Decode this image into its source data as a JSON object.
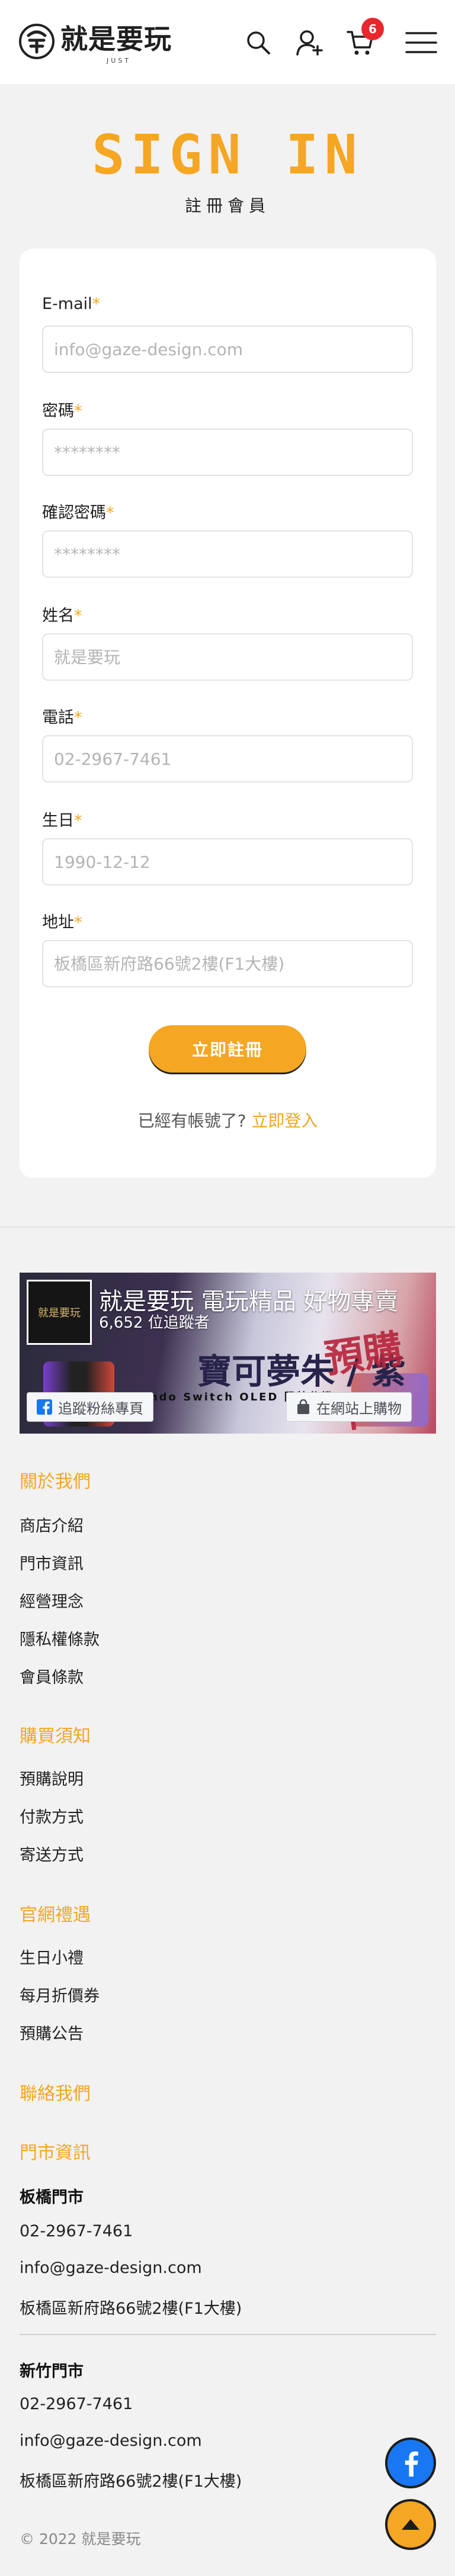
{
  "header": {
    "logo_text": "就是要玩",
    "logo_sub": "JUST",
    "cart_count": "6",
    "icons": [
      "search-icon",
      "user-add-icon",
      "cart-icon",
      "hamburger-menu-icon"
    ]
  },
  "page": {
    "title": "SIGN IN",
    "subtitle": "註冊會員"
  },
  "form": {
    "required_mark": "*",
    "fields": [
      {
        "label": "E-mail",
        "placeholder": "info@gaze-design.com",
        "type": "email"
      },
      {
        "label": "密碼",
        "placeholder": "********",
        "type": "password"
      },
      {
        "label": "確認密碼",
        "placeholder": "********",
        "type": "password"
      },
      {
        "label": "姓名",
        "placeholder": "就是要玩",
        "type": "text"
      },
      {
        "label": "電話",
        "placeholder": "02-2967-7461",
        "type": "tel"
      },
      {
        "label": "生日",
        "placeholder": "1990-12-12",
        "type": "text"
      },
      {
        "label": "地址",
        "placeholder": "板橋區新府路66號2樓(F1大樓)",
        "type": "text"
      }
    ],
    "submit_label": "立即註冊",
    "login_prompt": "已經有帳號了?",
    "login_link": "立即登入"
  },
  "facebook": {
    "page_name": "就是要玩 電玩精品 好物專賣",
    "likes": "6,652 位追蹤者",
    "follow_label": "追蹤粉絲專頁",
    "shop_label": "在網站上購物",
    "avatar_text": "就是要玩",
    "promo_big": "寶可夢朱 / 紫",
    "promo_red": "預購中",
    "promo_small": "Nintendo Switch OLED 限特仕機"
  },
  "footer": {
    "about": {
      "title": "關於我們",
      "links": [
        "商店介紹",
        "門市資訊",
        "經營理念",
        "隱私權條款",
        "會員條款"
      ]
    },
    "purchase": {
      "title": "購買須知",
      "links": [
        "預購說明",
        "付款方式",
        "寄送方式"
      ]
    },
    "gifts": {
      "title": "官網禮遇",
      "links": [
        "生日小禮",
        "每月折價券",
        "預購公告"
      ]
    },
    "contact": {
      "title": "聯絡我們"
    },
    "stores": {
      "title": "門市資訊",
      "list": [
        {
          "name": "板橋門市",
          "phone": "02-2967-7461",
          "email": "info@gaze-design.com",
          "address": "板橋區新府路66號2樓(F1大樓)"
        },
        {
          "name": "新竹門市",
          "phone": "02-2967-7461",
          "email": "info@gaze-design.com",
          "address": "板橋區新府路66號2樓(F1大樓)"
        }
      ]
    },
    "copyright": "© 2022 就是要玩"
  },
  "colors": {
    "accent": "#f5a623",
    "badge": "#e8262b",
    "facebook": "#1877f2",
    "background": "#f2f2f3"
  }
}
